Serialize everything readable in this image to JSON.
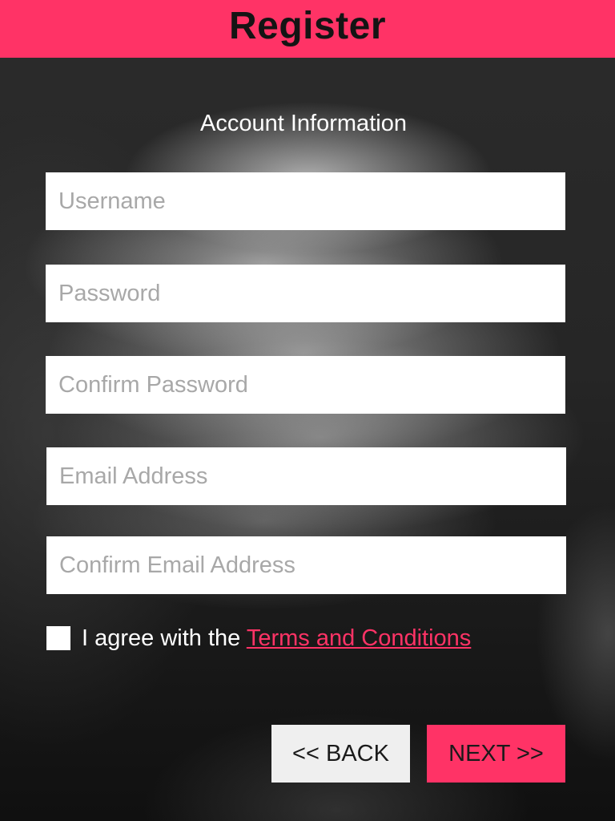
{
  "header": {
    "title": "Register"
  },
  "form": {
    "section_title": "Account Information",
    "fields": [
      {
        "placeholder": "Username",
        "value": ""
      },
      {
        "placeholder": "Password",
        "value": ""
      },
      {
        "placeholder": "Confirm Password",
        "value": ""
      },
      {
        "placeholder": "Email Address",
        "value": ""
      },
      {
        "placeholder": "Confirm Email Address",
        "value": ""
      }
    ],
    "agreement": {
      "checked": false,
      "text": "I agree with the ",
      "link_text": "Terms and Conditions"
    }
  },
  "buttons": {
    "back_label": "<< BACK",
    "next_label": "NEXT >>"
  },
  "colors": {
    "accent": "#ff3366",
    "field_background": "#ffffff",
    "back_button_background": "#efefef",
    "placeholder_text": "#a8a8a8"
  }
}
